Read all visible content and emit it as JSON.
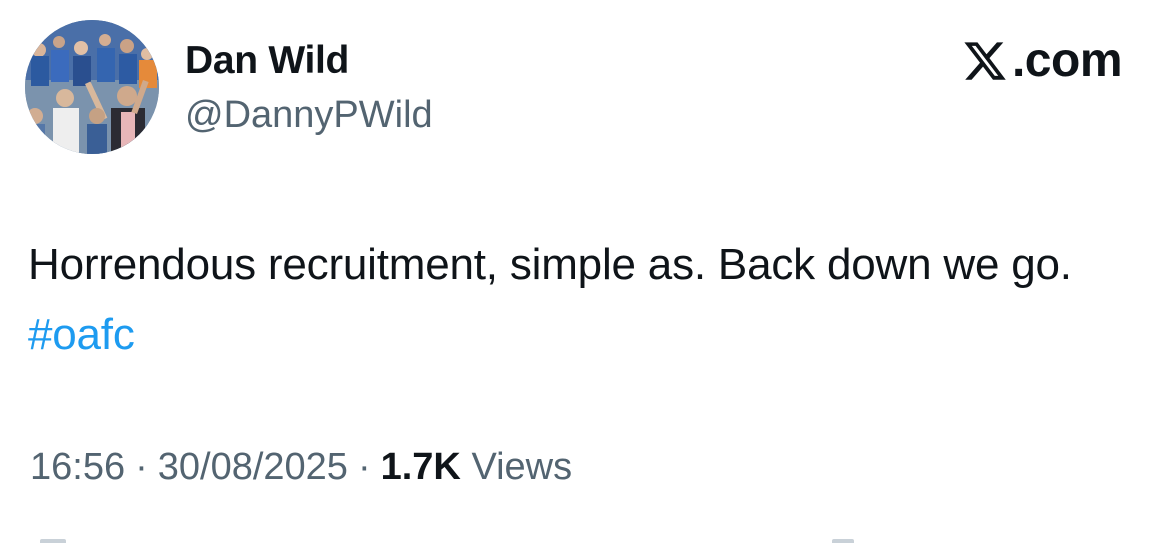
{
  "author": {
    "display_name": "Dan Wild",
    "handle": "@DannyPWild",
    "avatar": "crowd-photo-avatar"
  },
  "brand": {
    "icon": "x-logo-icon",
    "text": ".com"
  },
  "tweet": {
    "text": "Horrendous recruitment, simple as. Back down we go. ",
    "hashtag": "#oafc"
  },
  "meta": {
    "time": "16:56",
    "separator": "·",
    "date": "30/08/2025",
    "views_count": "1.7K",
    "views_label": "Views"
  },
  "colors": {
    "hashtag": "#1d9bf0",
    "secondary_text": "#536471",
    "primary_text": "#0f1419"
  }
}
